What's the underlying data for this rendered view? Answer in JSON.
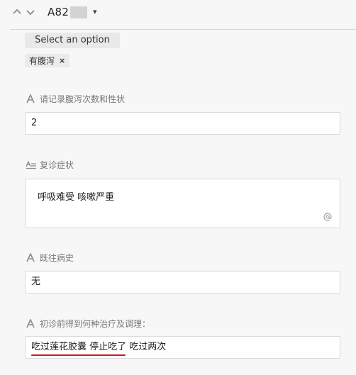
{
  "header": {
    "title": "A82",
    "nav_up_icon": "chevron-up-icon",
    "nav_down_icon": "chevron-down-icon",
    "title_caret": "▾"
  },
  "select": {
    "placeholder": "Select an option",
    "selected_tags": [
      {
        "label": "有腹泻",
        "remove_icon": "×"
      }
    ]
  },
  "fields": [
    {
      "label": "请记录腹泻次数和性状",
      "icon": "text-a-icon",
      "value": "2"
    },
    {
      "label": "复诊症状",
      "icon": "multiline-text-icon",
      "value": "呼吸难受 咳嗽严重",
      "mention_icon": "at-icon"
    },
    {
      "label": "既往病史",
      "icon": "text-a-icon",
      "value": "无"
    },
    {
      "label": "初诊前得到何种治疗及调理：",
      "icon": "text-a-icon",
      "value": "吃过莲花胶囊 停止吃了 吃过两次"
    }
  ],
  "colors": {
    "annotation_underline": "#c21f1f",
    "icon_gray": "#8a8a8a"
  }
}
